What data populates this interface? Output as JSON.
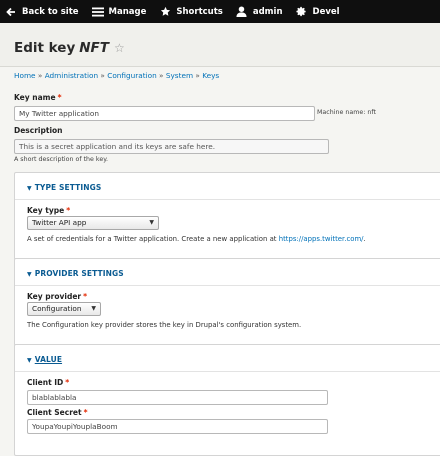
{
  "toolbar": {
    "back": "Back to site",
    "manage": "Manage",
    "shortcuts": "Shortcuts",
    "user": "admin",
    "devel": "Devel"
  },
  "page": {
    "title_prefix": "Edit key",
    "title_name": "NFT"
  },
  "breadcrumb": [
    "Home",
    "Administration",
    "Configuration",
    "System",
    "Keys"
  ],
  "key_name": {
    "label": "Key name",
    "value": "My Twitter application",
    "machine_name": "Machine name: nft"
  },
  "description": {
    "label": "Description",
    "value": "This is a secret application and its keys are safe here.",
    "help": "A short description of the key."
  },
  "type_settings": {
    "legend": "TYPE SETTINGS",
    "field_label": "Key type",
    "selected": "Twitter API app",
    "help": "A set of credentials for a Twitter application. Create a new application at",
    "link": "https://apps.twitter.com/",
    "help_end": "."
  },
  "provider_settings": {
    "legend": "PROVIDER SETTINGS",
    "field_label": "Key provider",
    "selected": "Configuration",
    "help": "The Configuration key provider stores the key in Drupal's configuration system."
  },
  "value": {
    "legend": "VALUE",
    "client_id_label": "Client ID",
    "client_id": "blablablabla",
    "client_secret_label": "Client Secret",
    "client_secret": "YoupaYoupiYouplaBoom"
  }
}
